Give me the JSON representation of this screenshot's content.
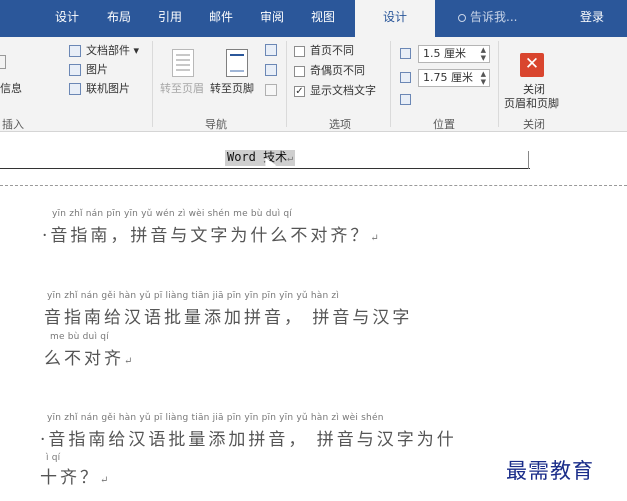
{
  "tabs": [
    "设计",
    "布局",
    "引用",
    "邮件",
    "审阅",
    "视图"
  ],
  "active_tab": "设计",
  "tell_me": "告诉我...",
  "login": "登录",
  "ribbon": {
    "insert_group": {
      "partial_info": "信息",
      "doc_parts": "文档部件 ▾",
      "picture": "图片",
      "online_picture": "联机图片",
      "group_label": "插入"
    },
    "nav_group": {
      "goto_header": "转至页眉",
      "goto_footer": "转至页脚",
      "group_label": "导航"
    },
    "options_group": {
      "first_page": "首页不同",
      "odd_even": "奇偶页不同",
      "show_text": "显示文档文字",
      "show_text_checked": "✓",
      "group_label": "选项"
    },
    "position_group": {
      "header_pos": "1.5 厘米",
      "footer_pos": "1.75 厘米",
      "group_label": "位置"
    },
    "close_group": {
      "close_line1": "关闭",
      "close_line2": "页眉和页脚",
      "group_label": "关闭"
    }
  },
  "document": {
    "header_text": "Word 技术",
    "para_mark": "↵",
    "lines": [
      {
        "pinyin": "yīn zhǐ nán   pīn yīn yǔ wén  zì wèi  shén me  bù duì qí",
        "hanzi": "·音指南，拼音与文字为什么不对齐？"
      },
      {
        "pinyin": "yīn zhǐ nán gěi hàn  yǔ   pī liàng tiān  jiā pīn yīn          pīn yīn   yǔ  hàn  zì",
        "hanzi": "音指南给汉语批量添加拼音， 拼音与汉字"
      },
      {
        "pinyin": "me   bù  duì  qí",
        "hanzi": "么不对齐"
      },
      {
        "pinyin": "yīn zhǐ nán gěi hàn yǔ pī liàng  tiān  jiā pīn yīn      pīn yīn yǔ hàn zì wèi shén",
        "hanzi": "·音指南给汉语批量添加拼音， 拼音与汉字为什"
      },
      {
        "pinyin": "ì qí",
        "hanzi": "十齐？"
      }
    ]
  },
  "watermark": "最需教育"
}
